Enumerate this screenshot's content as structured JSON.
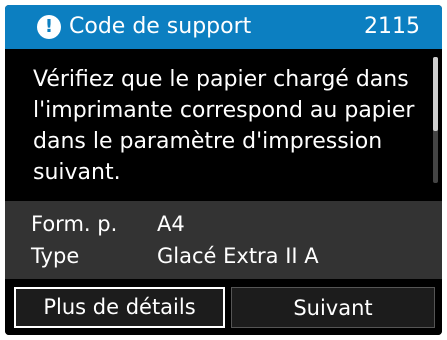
{
  "header": {
    "icon": "exclamation-icon",
    "icon_glyph": "!",
    "title": "Code de support",
    "code": "2115"
  },
  "message": "Vérifiez que le papier chargé dans l'imprimante correspond au papier dans le paramètre d'impression suivant.",
  "details": [
    {
      "label": "Form. p.",
      "value": "A4"
    },
    {
      "label": "Type",
      "value": "Glacé Extra II A"
    }
  ],
  "buttons": {
    "details_label": "Plus de détails",
    "next_label": "Suivant"
  },
  "colors": {
    "header_bg": "#0c7fc1",
    "screen_bg": "#000000",
    "details_bg": "#333333"
  }
}
